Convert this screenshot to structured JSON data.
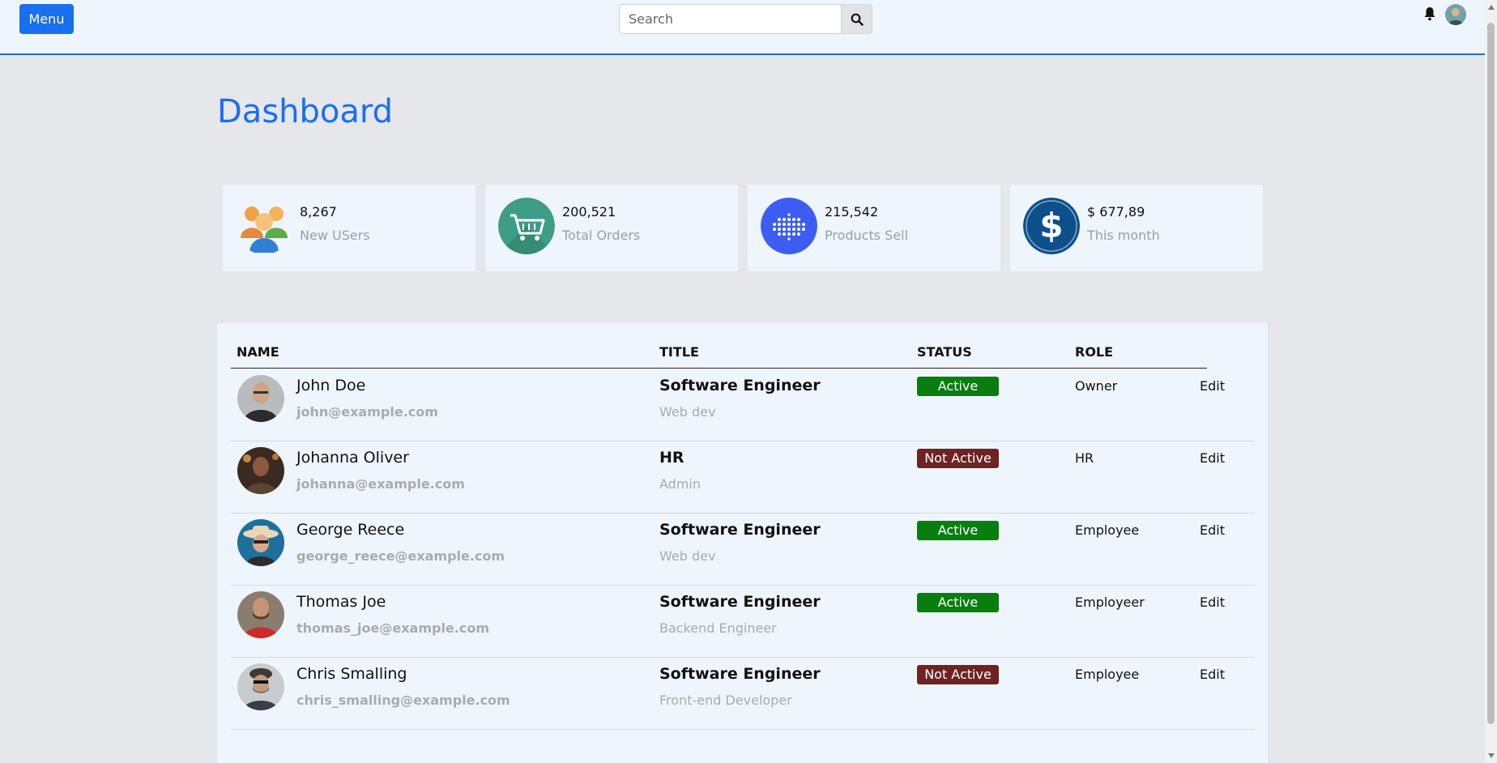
{
  "header": {
    "menu_label": "Menu",
    "search_placeholder": "Search"
  },
  "page": {
    "title": "Dashboard"
  },
  "stats": [
    {
      "value": "8,267",
      "label": "New USers",
      "icon": "users-icon"
    },
    {
      "value": "200,521",
      "label": "Total Orders",
      "icon": "cart-icon"
    },
    {
      "value": "215,542",
      "label": "Products Sell",
      "icon": "product-icon"
    },
    {
      "value": "$ 677,89",
      "label": "This month",
      "icon": "dollar-icon"
    }
  ],
  "table": {
    "headers": {
      "name": "NAME",
      "title": "TITLE",
      "status": "STATUS",
      "role": "ROLE"
    },
    "rows": [
      {
        "name": "John Doe",
        "email": "john@example.com",
        "title": "Software Engineer",
        "subtitle": "Web dev",
        "status": "Active",
        "role": "Owner",
        "action": "Edit"
      },
      {
        "name": "Johanna Oliver",
        "email": "johanna@example.com",
        "title": "HR",
        "subtitle": "Admin",
        "status": "Not Active",
        "role": "HR",
        "action": "Edit"
      },
      {
        "name": "George Reece",
        "email": "george_reece@example.com",
        "title": "Software Engineer",
        "subtitle": "Web dev",
        "status": "Active",
        "role": "Employee",
        "action": "Edit"
      },
      {
        "name": "Thomas Joe",
        "email": "thomas_joe@example.com",
        "title": "Software Engineer",
        "subtitle": "Backend Engineer",
        "status": "Active",
        "role": "Employeer",
        "action": "Edit"
      },
      {
        "name": "Chris Smalling",
        "email": "chris_smalling@example.com",
        "title": "Software Engineer",
        "subtitle": "Front-end Developer",
        "status": "Not Active",
        "role": "Employee",
        "action": "Edit"
      }
    ]
  },
  "colors": {
    "accent": "#1a6ef0",
    "active": "#0a7d10",
    "inactive": "#6e2323"
  }
}
